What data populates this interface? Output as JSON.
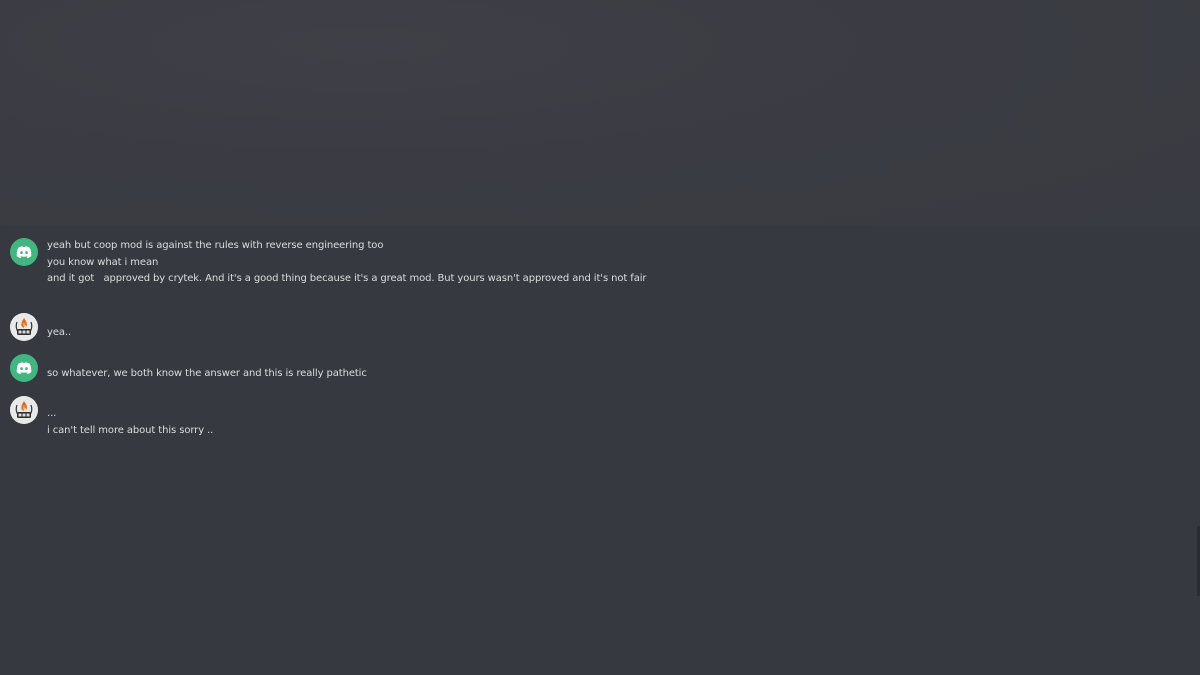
{
  "messages": [
    {
      "avatar": "discord-default-avatar-icon",
      "lines": [
        "yeah but coop mod is against the rules with reverse engineering too",
        "you know what i mean",
        "and it got   approved by crytek. And it's a good thing because it's a great mod. But yours wasn't approved and it's not fair"
      ]
    },
    {
      "avatar": "crew-logo-avatar-icon",
      "lines": [
        "yea.."
      ]
    },
    {
      "avatar": "discord-default-avatar-icon",
      "lines": [
        "so whatever, we both know the answer and this is really pathetic"
      ]
    },
    {
      "avatar": "crew-logo-avatar-icon",
      "lines": [
        "...",
        "i can't tell more about this sorry .."
      ]
    }
  ],
  "colors": {
    "background": "#36393f",
    "text": "#dcddde",
    "discord_avatar": "#43b581"
  }
}
